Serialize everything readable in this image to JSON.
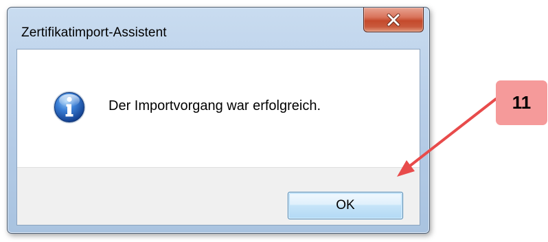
{
  "dialog": {
    "title": "Zertifikatimport-Assistent",
    "message": "Der Importvorgang war erfolgreich.",
    "ok_label": "OK",
    "close_icon": "close-icon",
    "message_icon": "information-icon"
  },
  "annotation": {
    "step_number": "11",
    "badge_color": "#f59a9a",
    "arrow_color": "#e84b4b"
  }
}
